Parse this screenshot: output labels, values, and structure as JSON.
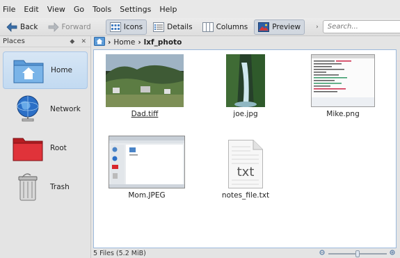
{
  "menubar": {
    "items": [
      {
        "label": "File"
      },
      {
        "label": "Edit"
      },
      {
        "label": "View"
      },
      {
        "label": "Go"
      },
      {
        "label": "Tools"
      },
      {
        "label": "Settings"
      },
      {
        "label": "Help"
      }
    ]
  },
  "toolbar": {
    "back_label": "Back",
    "forward_label": "Forward",
    "icons_label": "Icons",
    "details_label": "Details",
    "columns_label": "Columns",
    "preview_label": "Preview",
    "search_placeholder": "Search..."
  },
  "places": {
    "header": "Places",
    "items": [
      {
        "label": "Home",
        "icon": "home-folder-icon",
        "selected": true
      },
      {
        "label": "Network",
        "icon": "network-globe-icon"
      },
      {
        "label": "Root",
        "icon": "root-folder-icon"
      },
      {
        "label": "Trash",
        "icon": "trash-icon"
      }
    ]
  },
  "breadcrumb": {
    "segments": [
      "Home",
      "lxf_photo"
    ]
  },
  "files": [
    {
      "name": "Dad.tiff",
      "type": "image-landscape"
    },
    {
      "name": "joe.jpg",
      "type": "image-waterfall"
    },
    {
      "name": "Mike.png",
      "type": "image-screenshot"
    },
    {
      "name": "Mom.JPEG",
      "type": "image-desktop"
    },
    {
      "name": "notes_file.txt",
      "type": "text-file",
      "badge": "txt"
    }
  ],
  "status": {
    "text": "5 Files (5.2 MiB)",
    "zoom_fraction": 0.5
  },
  "colors": {
    "selection": "#c2daf1",
    "view_border": "#9bb9dc",
    "root_folder": "#d8262b"
  }
}
